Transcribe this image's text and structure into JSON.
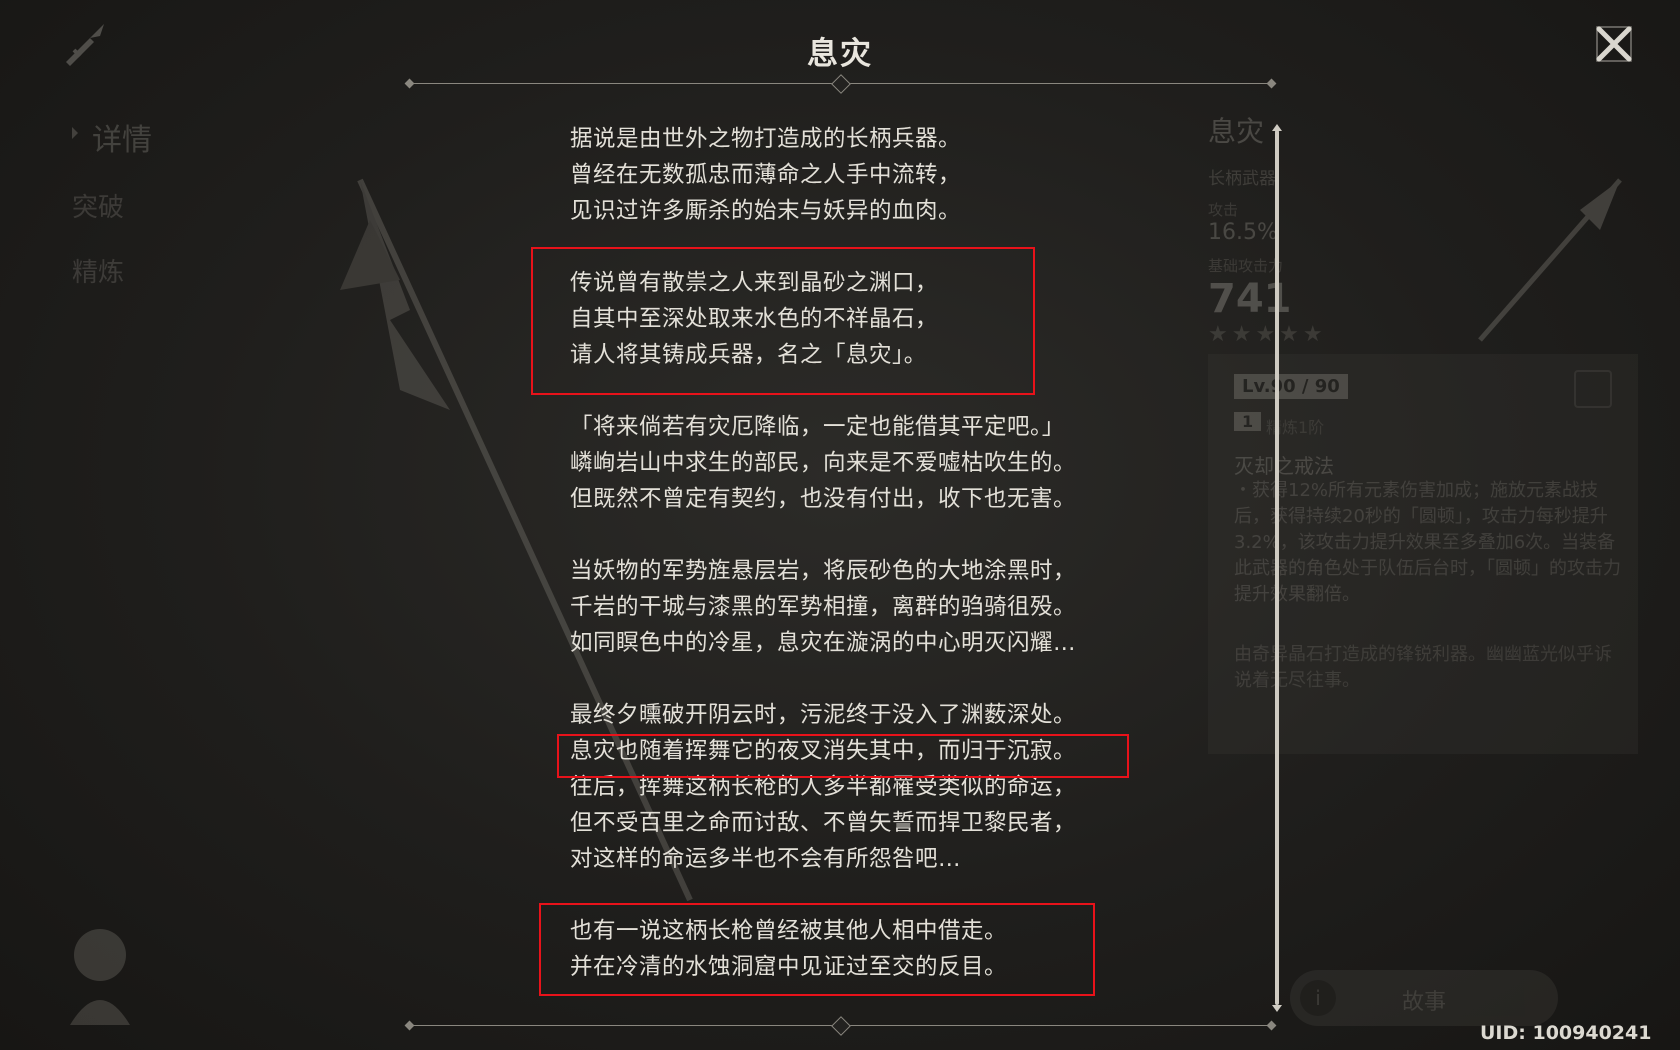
{
  "window": {
    "title": "息灾",
    "close_icon": "close-icon"
  },
  "background": {
    "breadcrumb": "",
    "nav": [
      {
        "label": "详情",
        "active": true
      },
      {
        "label": "突破",
        "active": false
      },
      {
        "label": "精炼",
        "active": false
      }
    ],
    "info": {
      "name": "息灾",
      "type": "长柄武器",
      "sub_stat_label": "攻击",
      "sub_stat_value": "16.5%",
      "base_atk_label": "基础攻击力",
      "base_atk_value": "741",
      "stars": "★★★★★"
    },
    "detail": {
      "level": "Lv.90 / 90",
      "refine_rank": "1",
      "refine_label": "精炼1阶",
      "passive_name": "灭却之戒法",
      "passive_desc": "・获得12%所有元素伤害加成；施放元素战技后，获得持续20秒的「圆顿」，攻击力每秒提升3.2%，该攻击力提升效果至多叠加6次。当装备此武器的角色处于队伍后台时，「圆顿」的攻击力提升效果翻倍。",
      "flavor": "由奇异晶石打造成的锋锐利器。幽幽蓝光似乎诉说着无尽往事。"
    },
    "story_button": {
      "label": "故事",
      "icon": "info-icon"
    }
  },
  "story": {
    "stanzas": [
      {
        "lines": [
          "据说是由世外之物打造成的长柄兵器。",
          "曾经在无数孤忠而薄命之人手中流转，",
          "见识过许多厮杀的始末与妖异的血肉。"
        ]
      },
      {
        "lines": [
          "传说曾有散祟之人来到晶砂之渊口，",
          "自其中至深处取来水色的不祥晶石，",
          "请人将其铸成兵器，名之「息灾」。"
        ]
      },
      {
        "lines": [
          "「将来倘若有灾厄降临，一定也能借其平定吧。」",
          "嶙峋岩山中求生的部民，向来是不爱嘘枯吹生的。",
          "但既然不曾定有契约，也没有付出，收下也无害。"
        ]
      },
      {
        "lines": [
          "当妖物的军势旌悬层岩，将辰砂色的大地涂黑时，",
          "千岩的干城与漆黑的军势相撞，离群的驺骑徂殁。",
          "如同瞑色中的冷星，息灾在漩涡的中心明灭闪耀…"
        ]
      },
      {
        "lines": [
          "最终夕曛破开阴云时，污泥终于没入了渊薮深处。",
          "息灾也随着挥舞它的夜叉消失其中，而归于沉寂。",
          "往后，挥舞这柄长枪的人多半都罹受类似的命运，",
          "但不受百里之命而讨敌、不曾矢誓而捍卫黎民者，",
          "对这样的命运多半也不会有所怨咎吧…"
        ]
      },
      {
        "lines": [
          "也有一说这柄长枪曾经被其他人相中借走。",
          "并在冷清的水蚀洞窟中见证过至交的反目。"
        ]
      }
    ]
  },
  "highlight_color": "#e8121a",
  "uid": "UID: 100940241"
}
